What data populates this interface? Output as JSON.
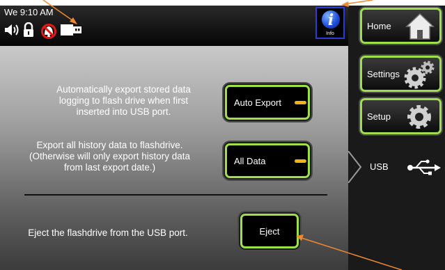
{
  "status_bar": {
    "time": "We 9:10 AM",
    "icons": [
      "speaker-icon",
      "lock-icon",
      "no-alarm-icon",
      "usb-drive-icon"
    ],
    "info_label": "Info"
  },
  "options": [
    {
      "description": "Automatically export stored data logging to flash drive when first inserted into USB port.",
      "button": "Auto Export"
    },
    {
      "description": "Export all history data to flashdrive. (Otherwise will only export history data from last export date.)",
      "button": "All Data"
    },
    {
      "description": "Eject the flashdrive from the USB port.",
      "button": "Eject"
    }
  ],
  "nav": {
    "home": "Home",
    "settings": "Settings",
    "setup": "Setup",
    "usb": "USB"
  },
  "colors": {
    "accent": "#9ee04a",
    "indicator": "#f2b21a",
    "annotation": "#f08a30"
  }
}
